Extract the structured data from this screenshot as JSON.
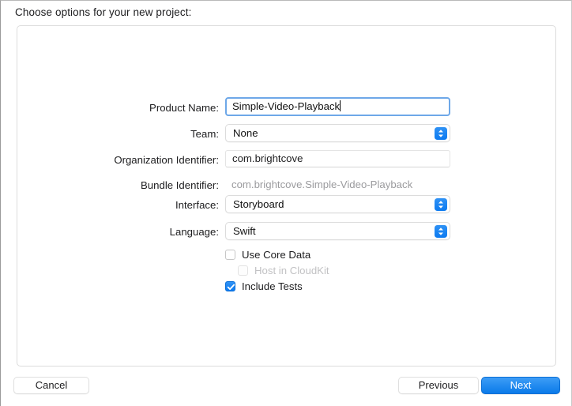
{
  "window": {
    "prompt": "Choose options for your new project:"
  },
  "form": {
    "fields": [
      {
        "label": "Product Name:",
        "type": "textfield-focused",
        "value": "Simple-Video-Playback",
        "name": "product-name"
      },
      {
        "label": "Team:",
        "type": "popup",
        "value": "None",
        "name": "team"
      },
      {
        "label": "Organization Identifier:",
        "type": "textfield",
        "value": "com.brightcove",
        "name": "organization-identifier"
      },
      {
        "label": "Bundle Identifier:",
        "type": "static",
        "value": "com.brightcove.Simple-Video-Playback",
        "name": "bundle-identifier"
      },
      {
        "label": "Interface:",
        "type": "popup",
        "value": "Storyboard",
        "name": "interface"
      },
      {
        "label": "Language:",
        "type": "popup",
        "value": "Swift",
        "name": "language"
      }
    ],
    "checkboxes": [
      {
        "label": "Use Core Data",
        "checked": false,
        "disabled": false,
        "name": "use-core-data"
      },
      {
        "label": "Host in CloudKit",
        "checked": false,
        "disabled": true,
        "name": "host-in-cloudkit"
      },
      {
        "label": "Include Tests",
        "checked": true,
        "disabled": false,
        "name": "include-tests"
      }
    ]
  },
  "footer": {
    "cancel_label": "Cancel",
    "previous_label": "Previous",
    "next_label": "Next"
  },
  "colors": {
    "accent": "#0a7ae9",
    "focus_ring": "#6ea8e8",
    "disabled_text": "#c2c2c4",
    "static_text": "#9b9b9e"
  }
}
